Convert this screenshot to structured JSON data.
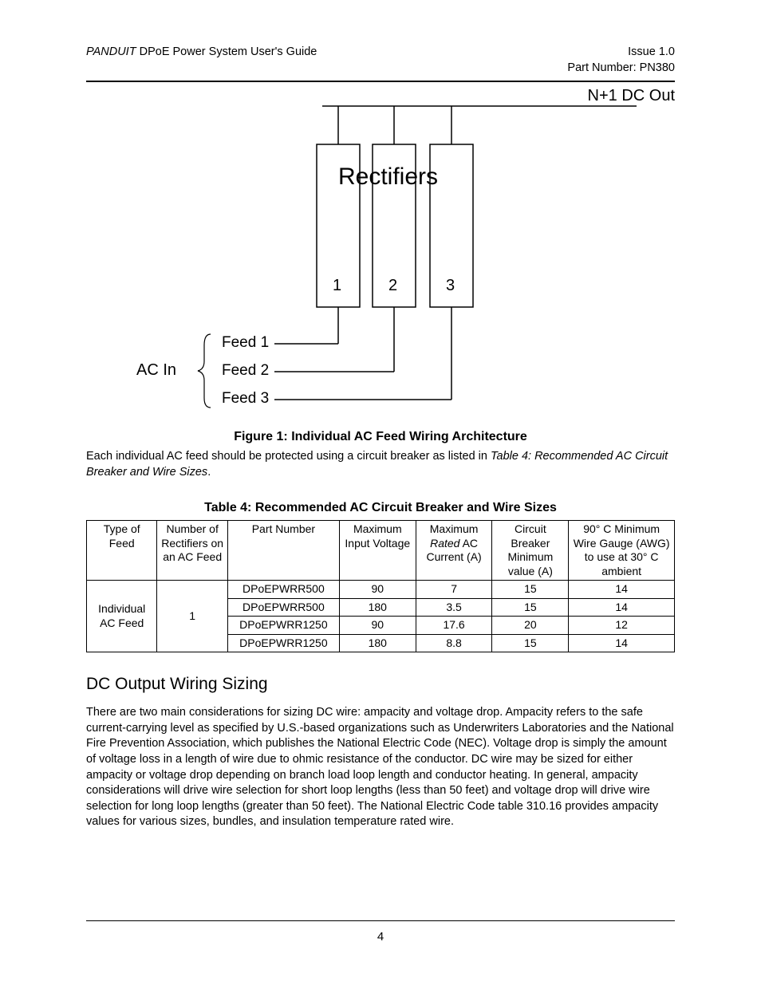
{
  "header": {
    "brand": "PANDUIT",
    "title_rest": " DPoE Power System User's Guide",
    "issue": "Issue 1.0",
    "part_number": "Part Number: PN380"
  },
  "diagram": {
    "dc_out_label": "N+1 DC Out",
    "rectifiers_label": "Rectifiers",
    "box_numbers": [
      "1",
      "2",
      "3"
    ],
    "ac_in_label": "AC In",
    "feeds": [
      "Feed 1",
      "Feed 2",
      "Feed 3"
    ]
  },
  "figure_caption": "Figure 1: Individual AC Feed Wiring Architecture",
  "para1_a": "Each individual AC feed should be protected using a circuit breaker as listed in ",
  "para1_b_italic": "Table 4: Recommended AC Circuit Breaker and Wire Sizes",
  "para1_c": ".",
  "table_caption": "Table 4: Recommended AC Circuit Breaker and Wire Sizes",
  "table_headers": {
    "c1": "Type of Feed",
    "c2": "Number of Rectifiers on an AC Feed",
    "c3": "Part Number",
    "c4": "Maximum Input Voltage",
    "c5_a": "Maximum ",
    "c5_b_italic": "Rated",
    "c5_c": " AC Current (A)",
    "c6": "Circuit Breaker Minimum value (A)",
    "c7": "90° C Minimum Wire Gauge (AWG) to use at 30° C ambient"
  },
  "table_span": {
    "type_of_feed": "Individual AC Feed",
    "num_rectifiers": "1"
  },
  "chart_data": {
    "type": "table",
    "columns": [
      "Part Number",
      "Maximum Input Voltage",
      "Maximum Rated AC Current (A)",
      "Circuit Breaker Minimum value (A)",
      "90° C Minimum Wire Gauge (AWG) to use at 30° C ambient"
    ],
    "rows": [
      {
        "part": "DPoEPWRR500",
        "voltage": "90",
        "current": "7",
        "breaker": "15",
        "awg": "14"
      },
      {
        "part": "DPoEPWRR500",
        "voltage": "180",
        "current": "3.5",
        "breaker": "15",
        "awg": "14"
      },
      {
        "part": "DPoEPWRR1250",
        "voltage": "90",
        "current": "17.6",
        "breaker": "20",
        "awg": "12"
      },
      {
        "part": "DPoEPWRR1250",
        "voltage": "180",
        "current": "8.8",
        "breaker": "15",
        "awg": "14"
      }
    ]
  },
  "section_heading": "DC Output Wiring Sizing",
  "para2": "There are two main considerations for sizing DC wire: ampacity and voltage drop.  Ampacity refers to the safe current-carrying level as specified by U.S.-based organizations such as Underwriters Laboratories and the National Fire Prevention Association, which publishes the National Electric Code (NEC).  Voltage drop is simply the amount of voltage loss in a length of wire due to ohmic resistance of the conductor.  DC wire may be sized for either ampacity or voltage drop depending on branch load loop length and conductor heating.  In general, ampacity considerations will drive wire selection for short loop lengths (less than 50 feet) and voltage drop will drive wire selection for long loop lengths (greater than 50 feet).  The National Electric Code table 310.16 provides ampacity values for various sizes, bundles, and insulation temperature rated wire.",
  "page_number": "4"
}
